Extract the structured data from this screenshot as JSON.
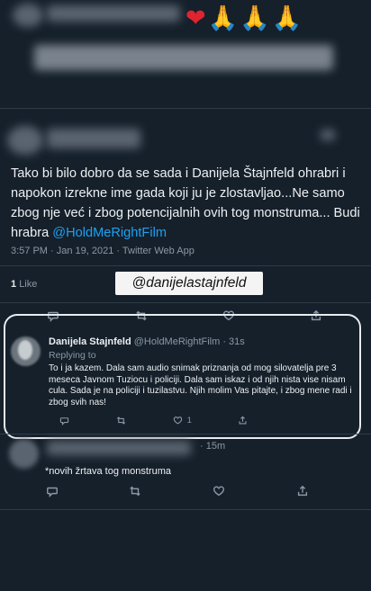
{
  "top": {
    "emojis": [
      "❤",
      "🙏",
      "🙏",
      "🙏"
    ]
  },
  "tweet": {
    "text_before_link": "Tako bi bilo dobro da se sada i Danijela Štajnfeld ohrabri i napokon izrekne ime gada koji ju je zlostavljao...Ne samo zbog nje već i zbog potencijalnih ovih tog monstruma... Budi hrabra ",
    "link": "@HoldMeRightFilm",
    "meta": "3:57 PM · Jan 19, 2021 · Twitter Web App",
    "likes_count": "1",
    "likes_label": "Like"
  },
  "overlay": {
    "handle_tag": "@danijelastajnfeld"
  },
  "reply": {
    "name": "Danijela Stajnfeld",
    "handle_time": "@HoldMeRightFilm · 31s",
    "replying_to": "Replying to",
    "text": "To i ja kazem. Dala sam audio snimak priznanja od mog silovatelja pre 3 meseca Javnom Tuziocu i policiji. Dala sam iskaz i od njih nista vise nisam cula. Sada je na policiji i tuzilastvu. Njih molim Vas pitajte, i zbog mene radi i zbog svih nas!",
    "like_count": "1"
  },
  "third": {
    "time": "· 15m",
    "text": "*novih žrtava tog monstruma"
  },
  "colors": {
    "background": "#15202b",
    "link": "#1da1f2",
    "heart": "#e0242f"
  },
  "icons": [
    "comment-icon",
    "retweet-icon",
    "heart-icon",
    "share-icon"
  ]
}
